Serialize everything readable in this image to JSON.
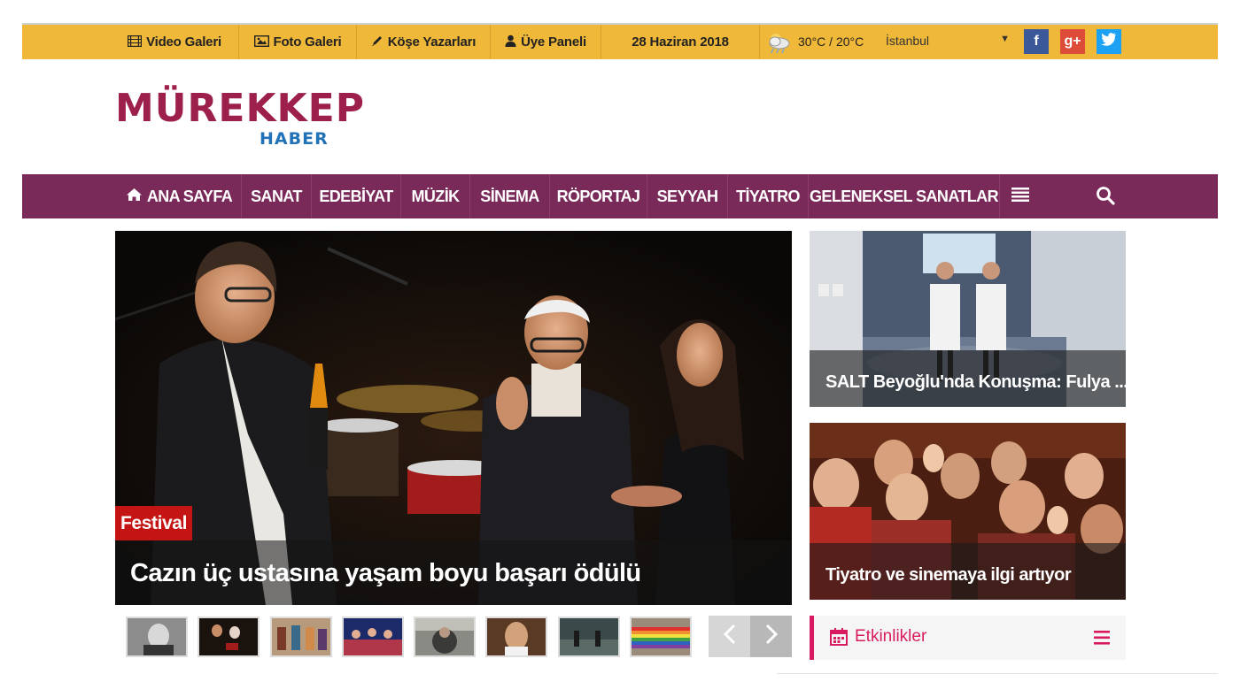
{
  "topbar": {
    "items": [
      {
        "label": "Video Galeri",
        "icon": "film-icon"
      },
      {
        "label": "Foto Galeri",
        "icon": "image-icon"
      },
      {
        "label": "Köşe Yazarları",
        "icon": "pencil-icon"
      },
      {
        "label": "Üye Paneli",
        "icon": "user-icon"
      }
    ],
    "date": "28 Haziran 2018",
    "weather": "30°C / 20°C",
    "city": "İstanbul",
    "social": {
      "facebook": "f",
      "googleplus": "g+",
      "twitter": "t"
    }
  },
  "logo": {
    "main": "MÜREKKEP",
    "sub": "HABER"
  },
  "nav": {
    "items": [
      "ANA SAYFA",
      "SANAT",
      "EDEBİYAT",
      "MÜZİK",
      "SİNEMA",
      "RÖPORTAJ",
      "SEYYAH",
      "TİYATRO",
      "GELENEKSEL SANATLAR"
    ]
  },
  "hero": {
    "category": "Festival",
    "title": "Cazın üç ustasına yaşam boyu başarı ödülü"
  },
  "side_cards": [
    {
      "title": "SALT Beyoğlu'nda Konuşma: Fulya ..."
    },
    {
      "title": "Tiyatro ve sinemaya ilgi artıyor"
    }
  ],
  "slider": {
    "prev": "‹",
    "next": "›"
  },
  "events": {
    "title": "Etkinlikler"
  },
  "colors": {
    "topbar": "#f0b838",
    "nav": "#7a2a59",
    "logo_primary": "#9c1f4c",
    "logo_secondary": "#2272b8",
    "badge": "#c41414",
    "events_accent": "#d81b60"
  }
}
